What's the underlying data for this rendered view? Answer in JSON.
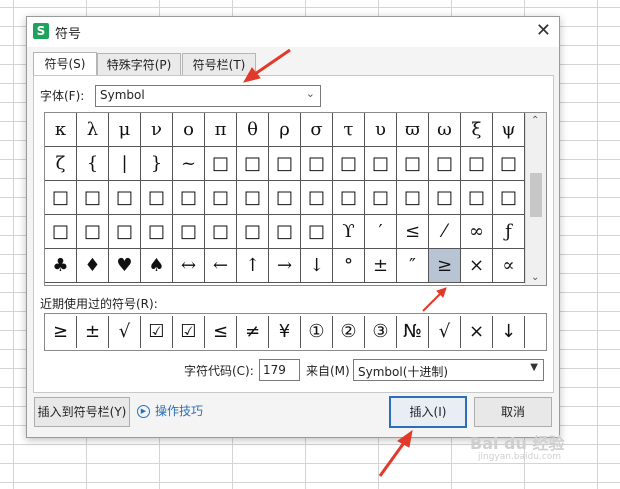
{
  "dialog": {
    "title": "符号",
    "close_glyph": "✕",
    "app_icon_letter": "S",
    "tabs": [
      {
        "label": "符号(S)",
        "active": true
      },
      {
        "label": "特殊字符(P)",
        "active": false
      },
      {
        "label": "符号栏(T)",
        "active": false
      }
    ],
    "font_label": "字体(F):",
    "font_value": "Symbol",
    "symbols": [
      [
        "κ",
        "λ",
        "μ",
        "ν",
        "ο",
        "π",
        "θ",
        "ρ",
        "σ",
        "τ",
        "υ",
        "ϖ",
        "ω",
        "ξ",
        "ψ"
      ],
      [
        "ζ",
        "{",
        "|",
        "}",
        "~",
        "□",
        "□",
        "□",
        "□",
        "□",
        "□",
        "□",
        "□",
        "□",
        "□"
      ],
      [
        "□",
        "□",
        "□",
        "□",
        "□",
        "□",
        "□",
        "□",
        "□",
        "□",
        "□",
        "□",
        "□",
        "□",
        "□"
      ],
      [
        "□",
        "□",
        "□",
        "□",
        "□",
        "□",
        "□",
        "□",
        "□",
        "ϒ",
        "′",
        "≤",
        "⁄",
        "∞",
        "ƒ"
      ],
      [
        "♣",
        "♦",
        "♥",
        "♠",
        "↔",
        "←",
        "↑",
        "→",
        "↓",
        "°",
        "±",
        "″",
        "≥",
        "×",
        "∝"
      ]
    ],
    "selected_symbol": "≥",
    "recent_label": "近期使用过的符号(R):",
    "recent_symbols": [
      "≥",
      "±",
      "√",
      "☑",
      "☑",
      "≤",
      "≠",
      "¥",
      "①",
      "②",
      "③",
      "№",
      "√",
      "×",
      "↓"
    ],
    "char_code_label": "字符代码(C):",
    "char_code_value": "179",
    "from_label": "来自(M)",
    "from_value": "Symbol(十进制)",
    "insert_to_bar_button": "插入到符号栏(Y)",
    "tips_label": "操作技巧",
    "insert_button": "插入(I)",
    "cancel_button": "取消"
  },
  "watermark": {
    "line1": "Bai du 经验",
    "line2": "jingyan.baidu.com"
  },
  "colors": {
    "accent": "#2b6fb8",
    "arrow": "#e23a2a",
    "selected_cell": "#b8c4d4",
    "app_icon": "#1fa35c"
  }
}
